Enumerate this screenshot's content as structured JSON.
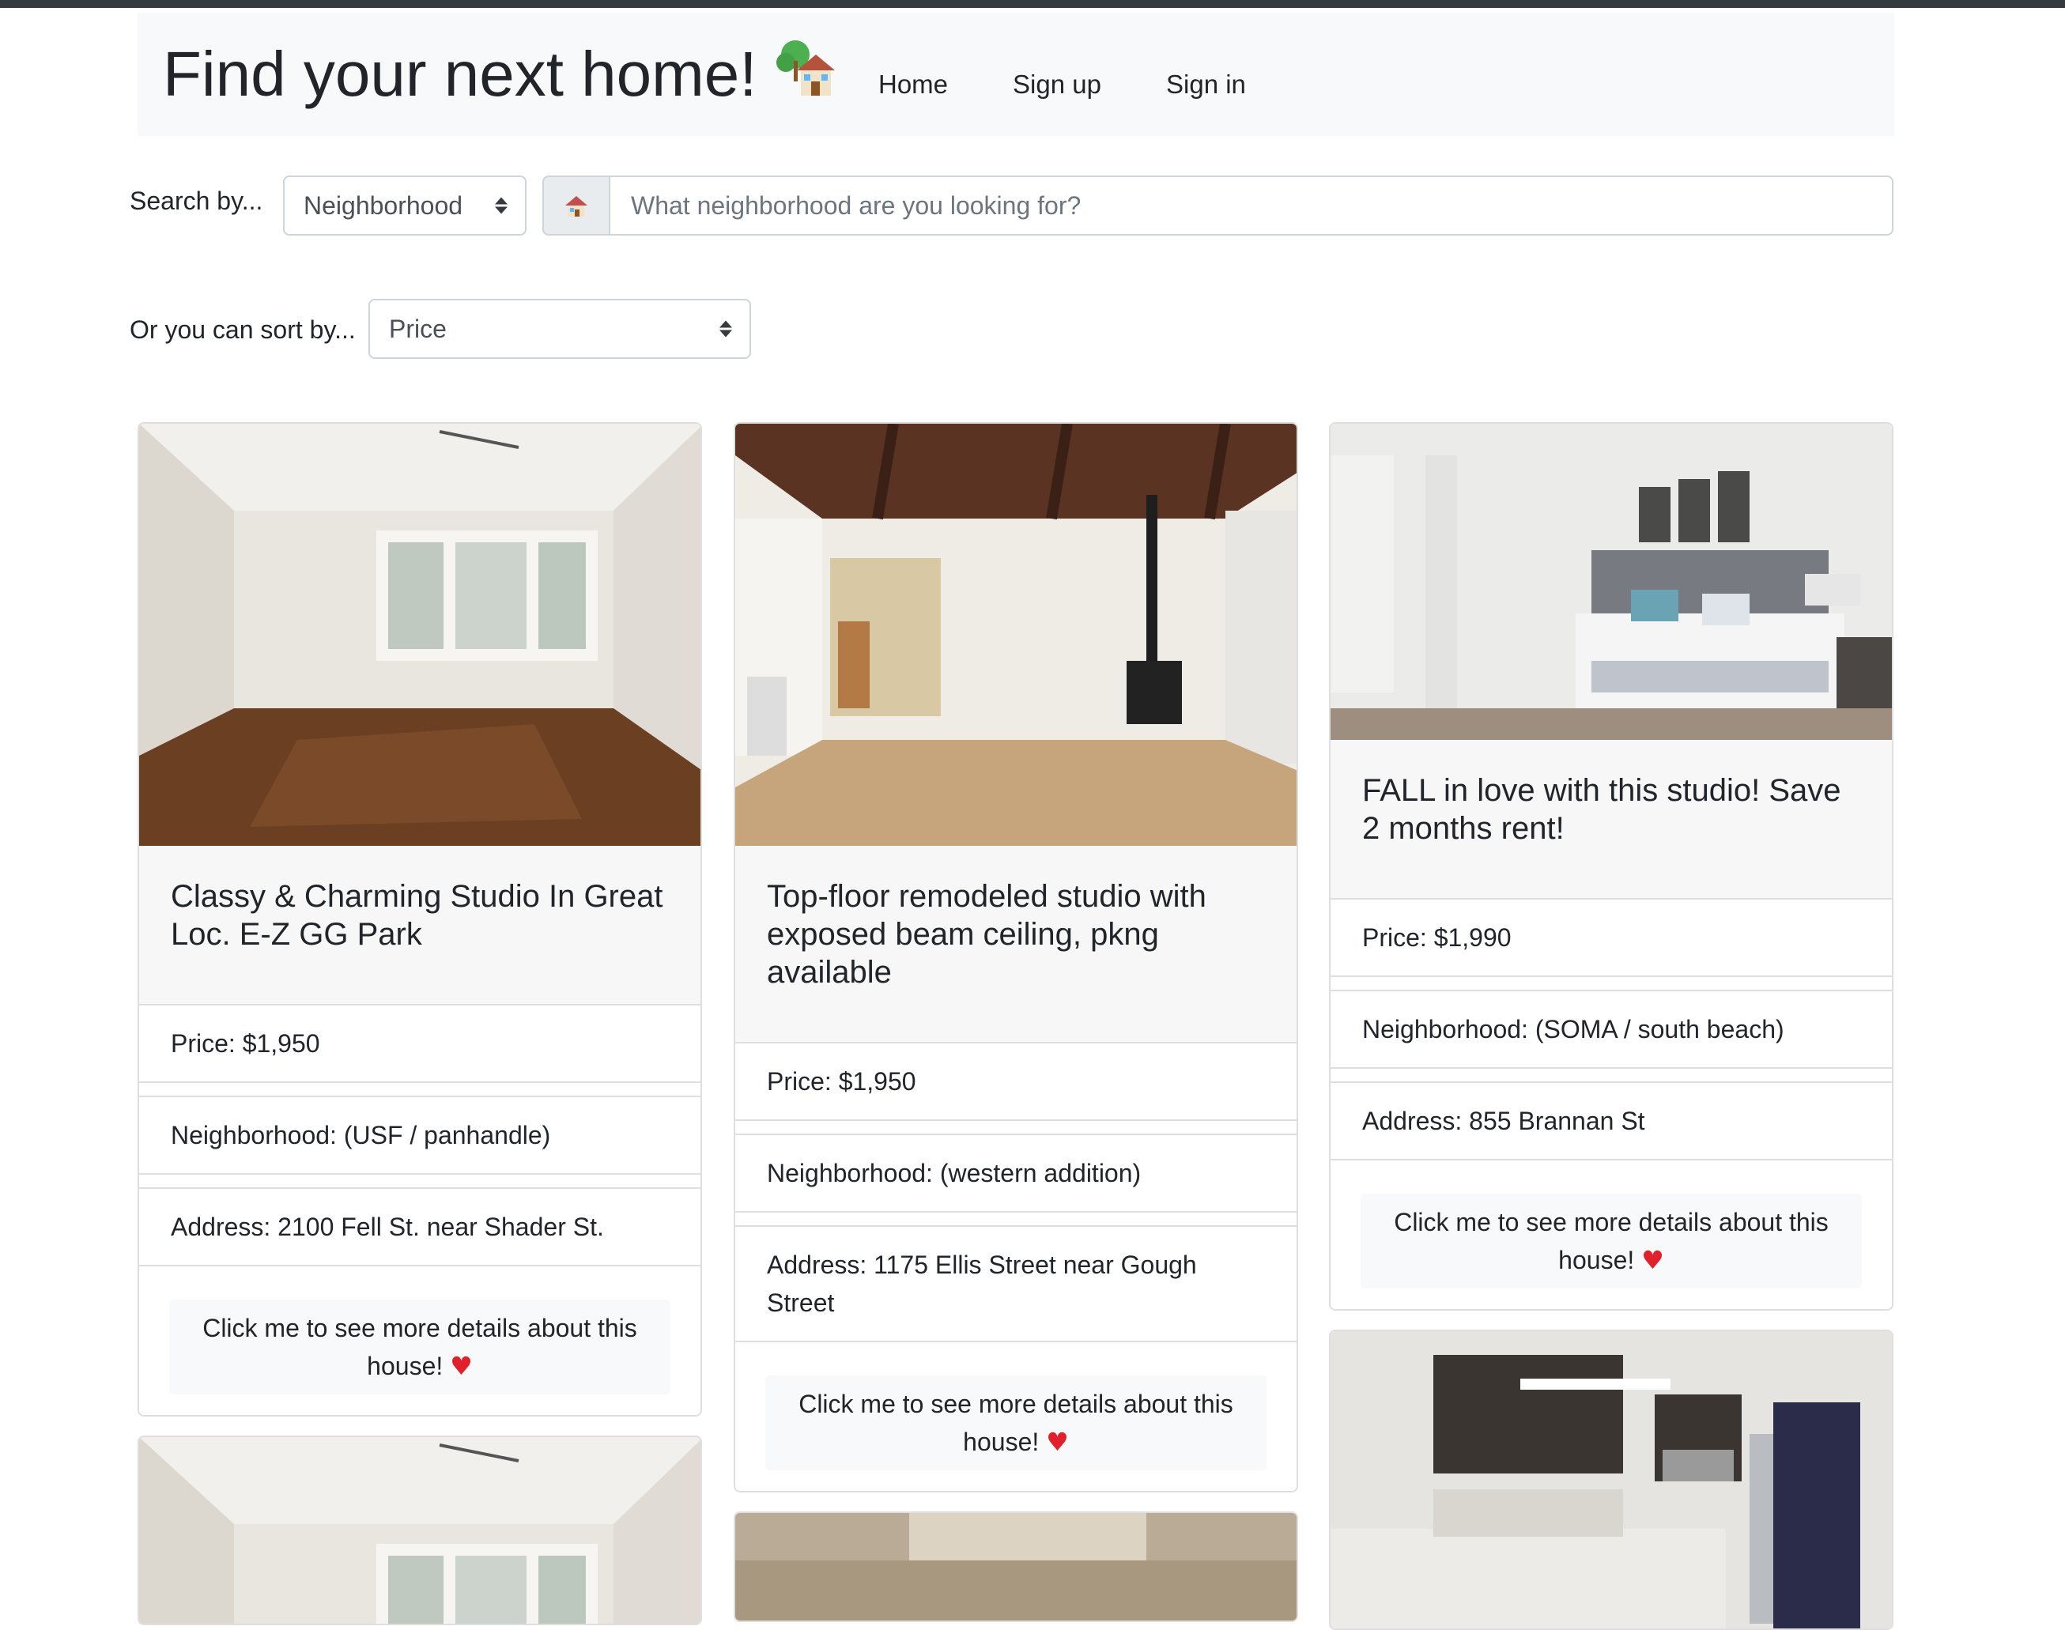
{
  "navbar": {
    "brand": "Find your next home!",
    "brand_icon": "house-with-garden-emoji",
    "links": [
      "Home",
      "Sign up",
      "Sign in"
    ]
  },
  "search": {
    "label": "Search by...",
    "select_value": "Neighborhood",
    "addon_icon": "house-emoji",
    "placeholder": "What neighborhood are you looking for?"
  },
  "sort": {
    "label": "Or you can sort by...",
    "select_value": "Price"
  },
  "listings": [
    {
      "title": "Classy & Charming Studio In Great Loc. E-Z GG Park",
      "price": "Price: $1,950",
      "neighborhood": "Neighborhood: (USF / panhandle)",
      "address": "Address: 2100 Fell St. near Shader St.",
      "button": "Click me to see more details about this house!"
    },
    {
      "title": "Top-floor remodeled studio with exposed beam ceiling, pkng available",
      "price": "Price: $1,950",
      "neighborhood": "Neighborhood: (western addition)",
      "address": "Address: 1175 Ellis Street near Gough Street",
      "button": "Click me to see more details about this house!"
    },
    {
      "title": "FALL in love with this studio! Save 2 months rent!",
      "price": "Price: $1,990",
      "neighborhood": "Neighborhood: (SOMA / south beach)",
      "address": "Address: 855 Brannan St",
      "button": "Click me to see more details about this house!"
    }
  ],
  "colors": {
    "heart": "#e0202a",
    "navbar_bg": "#f8f9fa",
    "card_header_bg": "#f7f7f7"
  }
}
